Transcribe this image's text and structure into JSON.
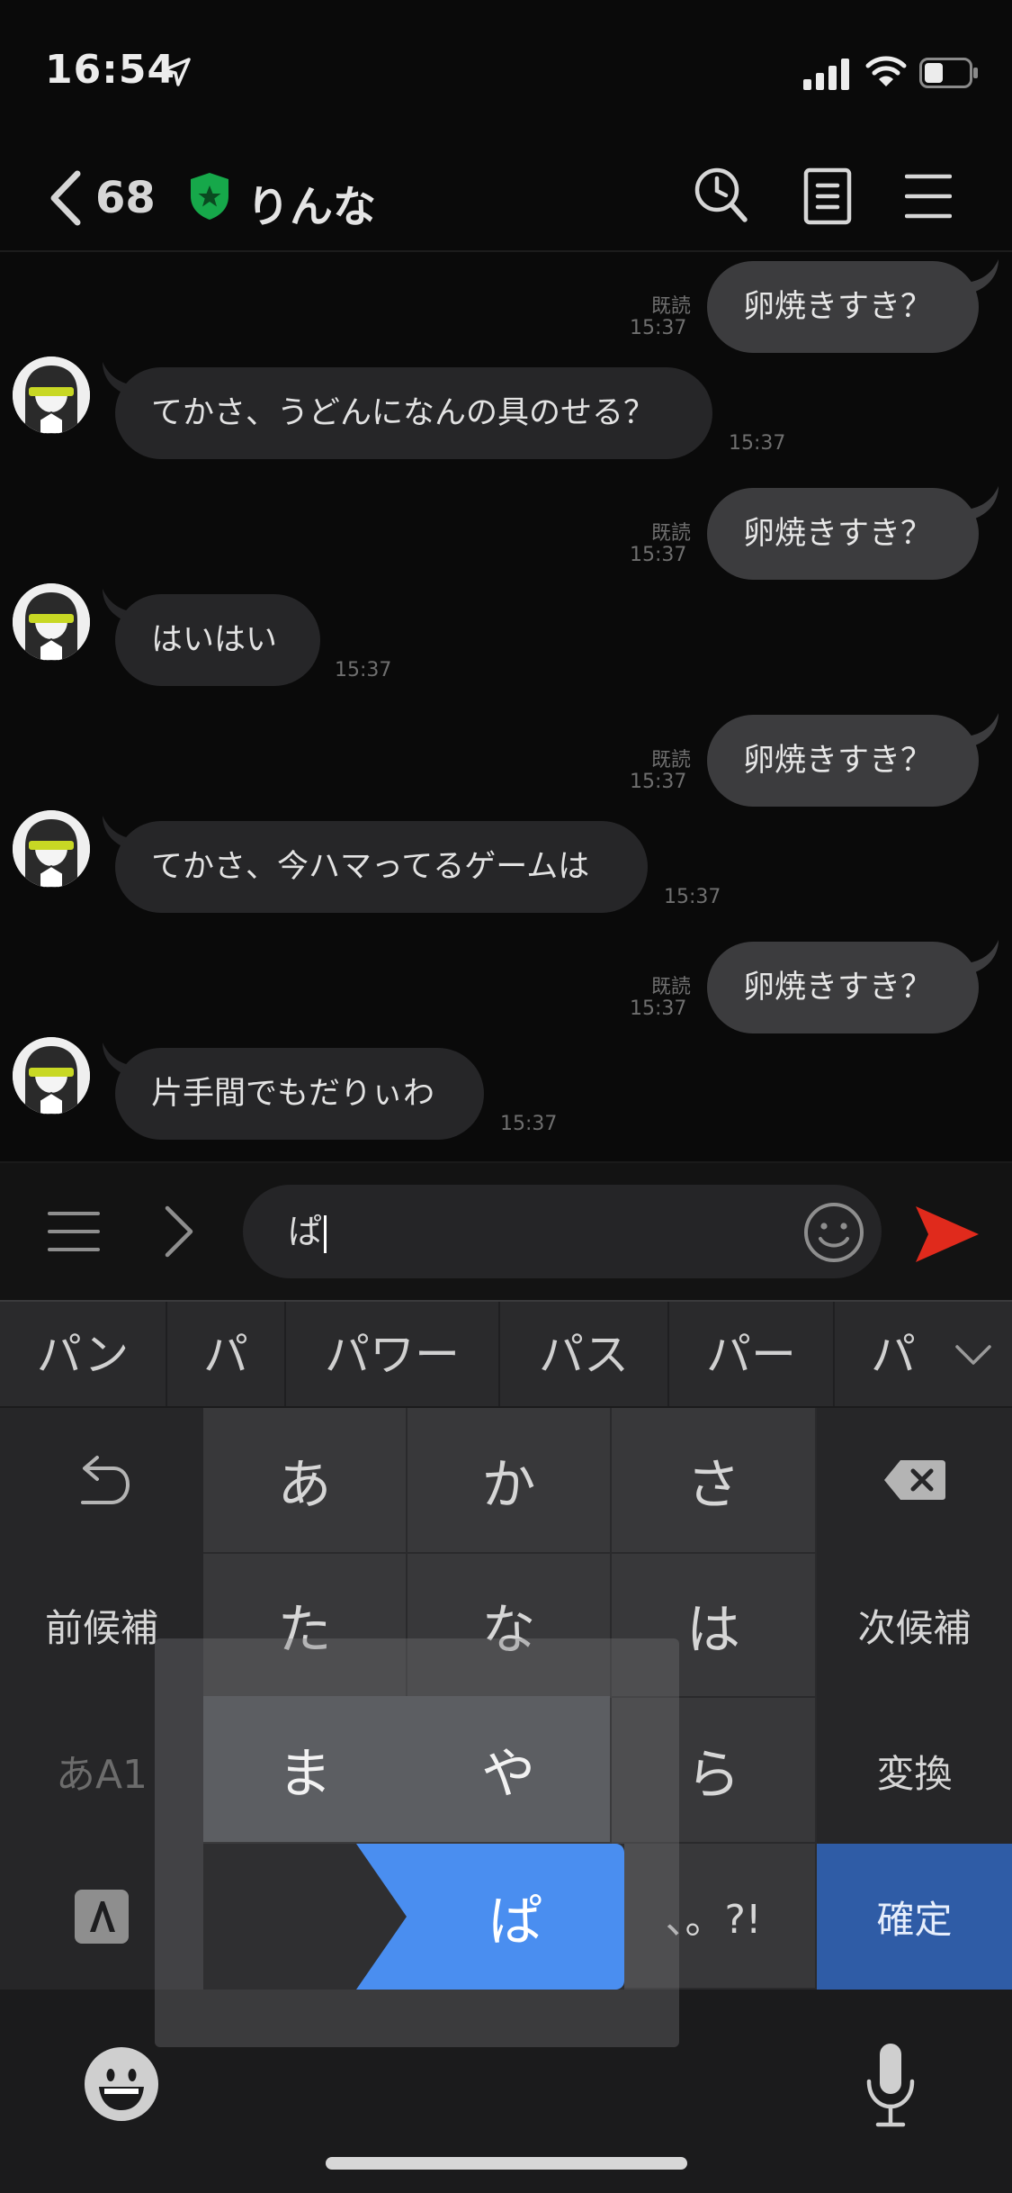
{
  "status_bar": {
    "time": "16:54"
  },
  "header": {
    "back_count": "68",
    "chat_name": "りんな"
  },
  "messages": [
    {
      "side": "out",
      "text": "卵焼きすき？",
      "read": "既読",
      "time": "15:37"
    },
    {
      "side": "in",
      "text": "てかさ、うどんになんの具のせる？",
      "time": "15:37"
    },
    {
      "side": "out",
      "text": "卵焼きすき？",
      "read": "既読",
      "time": "15:37"
    },
    {
      "side": "in",
      "text": "はいはい",
      "time": "15:37"
    },
    {
      "side": "out",
      "text": "卵焼きすき？",
      "read": "既読",
      "time": "15:37"
    },
    {
      "side": "in",
      "text": "てかさ、今ハマってるゲームは",
      "time": "15:37"
    },
    {
      "side": "out",
      "text": "卵焼きすき？",
      "read": "既読",
      "time": "15:37"
    },
    {
      "side": "in",
      "text": "片手間でもだりぃわ",
      "time": "15:37"
    }
  ],
  "composer": {
    "input_value": "ぱ"
  },
  "keyboard": {
    "candidates": [
      "パン",
      "パ",
      "パワー",
      "パス",
      "パー",
      "パ"
    ],
    "row1": [
      "あ",
      "か",
      "さ"
    ],
    "row2": [
      "前候補",
      "た",
      "な",
      "は",
      "次候補"
    ],
    "row3": [
      "あA1",
      "ま",
      "や",
      "ら",
      "変換"
    ],
    "row4": [
      "ぱ",
      "、。?!",
      "確定"
    ]
  },
  "colors": {
    "send": "#e02a1c",
    "shield": "#16a84a",
    "flick": "#4a8ef0",
    "confirm": "#2f5ca6"
  },
  "icons": [
    "location-arrow-icon",
    "signal-icon",
    "wifi-icon",
    "battery-icon",
    "back-chevron-icon",
    "shield-star-icon",
    "search-history-icon",
    "notes-icon",
    "hamburger-menu-icon",
    "chevron-right-icon",
    "smiley-icon",
    "send-icon",
    "chevron-down-icon",
    "undo-icon",
    "backspace-icon",
    "toolbar-logo-icon",
    "emoji-icon",
    "microphone-icon"
  ]
}
